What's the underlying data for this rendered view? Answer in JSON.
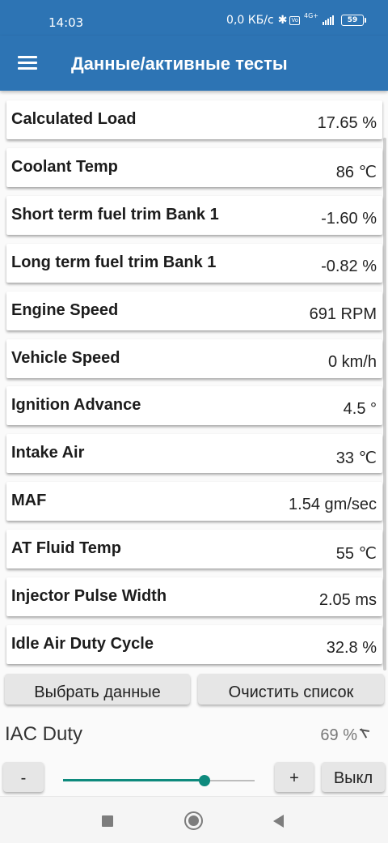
{
  "status_bar": {
    "time": "14:03",
    "network_speed": "0,0 КБ/с",
    "signal_label": "4G+",
    "battery": "59"
  },
  "app_bar": {
    "title": "Данные/активные тесты",
    "menu_icon": "hamburger-menu-icon"
  },
  "parameters": [
    {
      "name": "Calculated Load",
      "value": "17.65 %"
    },
    {
      "name": "Coolant Temp",
      "value": "86 ℃"
    },
    {
      "name": "Short term fuel trim Bank 1",
      "value": "-1.60 %"
    },
    {
      "name": "Long term fuel trim Bank 1",
      "value": "-0.82 %"
    },
    {
      "name": "Engine Speed",
      "value": "691 RPM"
    },
    {
      "name": "Vehicle Speed",
      "value": "0 km/h"
    },
    {
      "name": "Ignition Advance",
      "value": "4.5 °"
    },
    {
      "name": "Intake Air",
      "value": "33 ℃"
    },
    {
      "name": "MAF",
      "value": "1.54 gm/sec"
    },
    {
      "name": "AT Fluid Temp",
      "value": "55 ℃"
    },
    {
      "name": "Injector Pulse Width",
      "value": "2.05 ms"
    },
    {
      "name": "Idle Air Duty Cycle",
      "value": "32.8 %"
    }
  ],
  "actions": {
    "select_label": "Выбрать данные",
    "clear_label": "Очистить список"
  },
  "active_test": {
    "label": "IAC Duty",
    "value": "69 %",
    "slider_level": 0.74,
    "minus_label": "-",
    "plus_label": "+",
    "off_label": "Выкл"
  },
  "colors": {
    "primary": "#2d74b4",
    "accent": "#0e8a7d",
    "background": "#fafafa"
  }
}
